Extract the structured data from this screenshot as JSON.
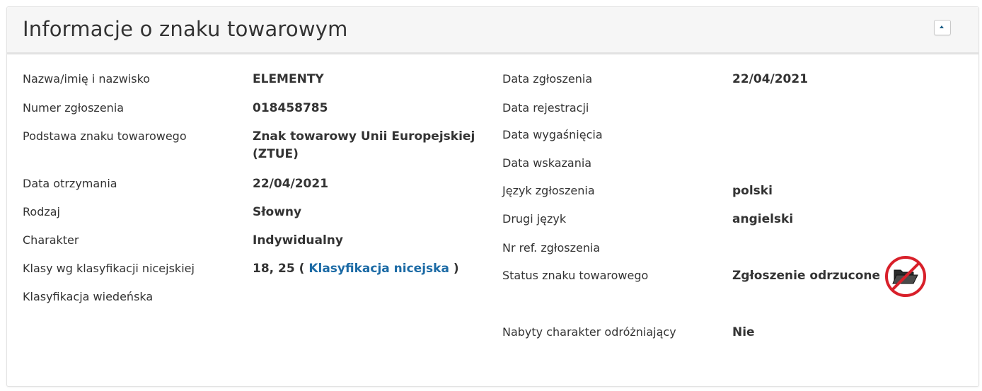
{
  "panel": {
    "title": "Informacje o znaku towarowym",
    "collapse_label": "Zwiń"
  },
  "left": {
    "name_label": "Nazwa/imię i nazwisko",
    "name_value": "ELEMENTY",
    "number_label": "Numer zgłoszenia",
    "number_value": "018458785",
    "basis_label": "Podstawa znaku towarowego",
    "basis_value_line1": "Znak towarowy Unii Europejskiej",
    "basis_value_line2": "(ZTUE)",
    "received_label": "Data otrzymania",
    "received_value": "22/04/2021",
    "type_label": "Rodzaj",
    "type_value": "Słowny",
    "nature_label": "Charakter",
    "nature_value": "Indywidualny",
    "nice_label": "Klasy wg klasyfikacji nicejskiej",
    "nice_value_prefix": "18, 25 (",
    "nice_link": "Klasyfikacja nicejska",
    "nice_value_suffix": ")",
    "vienna_label": "Klasyfikacja wiedeńska"
  },
  "right": {
    "filing_date_label": "Data zgłoszenia",
    "filing_date_value": "22/04/2021",
    "registration_date_label": "Data rejestracji",
    "expiry_date_label": "Data wygaśnięcia",
    "designation_date_label": "Data wskazania",
    "filing_language_label": "Język zgłoszenia",
    "filing_language_value": "polski",
    "second_language_label": "Drugi język",
    "second_language_value": "angielski",
    "filing_ref_label": "Nr ref. zgłoszenia",
    "status_label": "Status znaku towarowego",
    "status_value": "Zgłoszenie odrzucone",
    "status_icon": "rejected-folder-icon",
    "distinctiveness_label": "Nabyty charakter odróżniający",
    "distinctiveness_value": "Nie"
  },
  "colors": {
    "link": "#1b6aa5",
    "status_icon_ring": "#d8202a",
    "header_background": "#f6f6f6"
  }
}
